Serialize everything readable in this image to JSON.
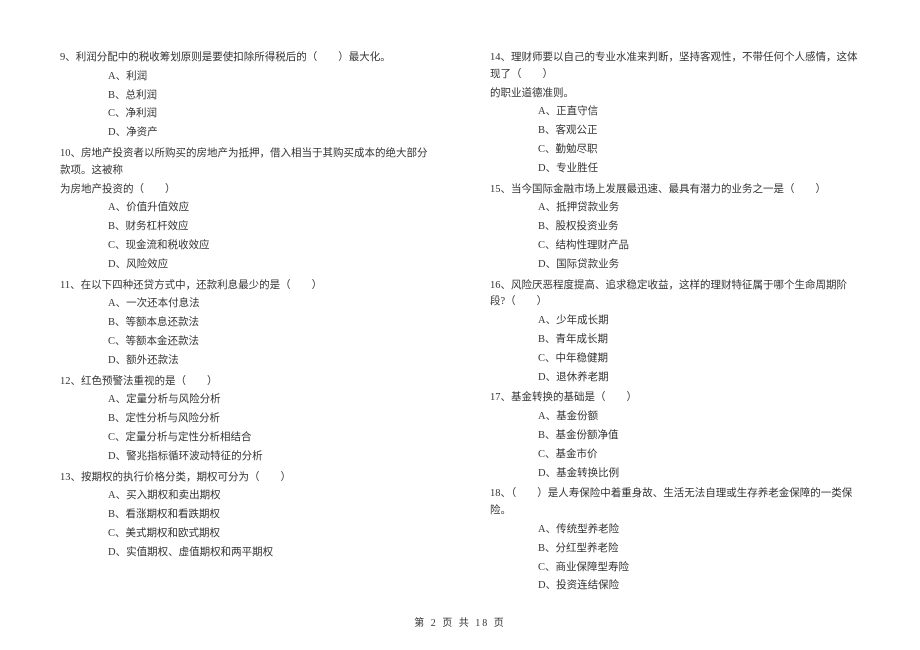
{
  "left": {
    "q9": {
      "text": "9、利润分配中的税收筹划原则是要使扣除所得税后的（　　）最大化。",
      "a": "A、利润",
      "b": "B、总利润",
      "c": "C、净利润",
      "d": "D、净资产"
    },
    "q10": {
      "text1": "10、房地产投资者以所购买的房地产为抵押，借入相当于其购买成本的绝大部分款项。这被称",
      "text2": "为房地产投资的（　　）",
      "a": "A、价值升值效应",
      "b": "B、财务杠杆效应",
      "c": "C、现金流和税收效应",
      "d": "D、风险效应"
    },
    "q11": {
      "text": "11、在以下四种还贷方式中，还款利息最少的是（　　）",
      "a": "A、一次还本付息法",
      "b": "B、等额本息还款法",
      "c": "C、等额本金还款法",
      "d": "D、额外还款法"
    },
    "q12": {
      "text": "12、红色预警法重视的是（　　）",
      "a": "A、定量分析与风险分析",
      "b": "B、定性分析与风险分析",
      "c": "C、定量分析与定性分析相结合",
      "d": "D、警兆指标循环波动特征的分析"
    },
    "q13": {
      "text": "13、按期权的执行价格分类，期权可分为（　　）",
      "a": "A、买入期权和卖出期权",
      "b": "B、看涨期权和看跌期权",
      "c": "C、美式期权和欧式期权",
      "d": "D、实值期权、虚值期权和两平期权"
    }
  },
  "right": {
    "q14": {
      "text1": "14、理财师要以自己的专业水准来判断，坚持客观性，不带任何个人感情，这体现了（　　）",
      "text2": "的职业道德准则。",
      "a": "A、正直守信",
      "b": "B、客观公正",
      "c": "C、勤勉尽职",
      "d": "D、专业胜任"
    },
    "q15": {
      "text": "15、当今国际金融市场上发展最迅速、最具有潜力的业务之一是（　　）",
      "a": "A、抵押贷款业务",
      "b": "B、股权投资业务",
      "c": "C、结构性理财产品",
      "d": "D、国际贷款业务"
    },
    "q16": {
      "text": "16、风险厌恶程度提高、追求稳定收益，这样的理财特征属于哪个生命周期阶段?（　　）",
      "a": "A、少年成长期",
      "b": "B、青年成长期",
      "c": "C、中年稳健期",
      "d": "D、退休养老期"
    },
    "q17": {
      "text": "17、基金转换的基础是（　　）",
      "a": "A、基金份额",
      "b": "B、基金份额净值",
      "c": "C、基金市价",
      "d": "D、基金转换比例"
    },
    "q18": {
      "text": "18、（　　）是人寿保险中着重身故、生活无法自理或生存养老金保障的一类保险。",
      "a": "A、传统型养老险",
      "b": "B、分红型养老险",
      "c": "C、商业保障型寿险",
      "d": "D、投资连结保险"
    }
  },
  "footer": "第 2 页 共 18 页"
}
